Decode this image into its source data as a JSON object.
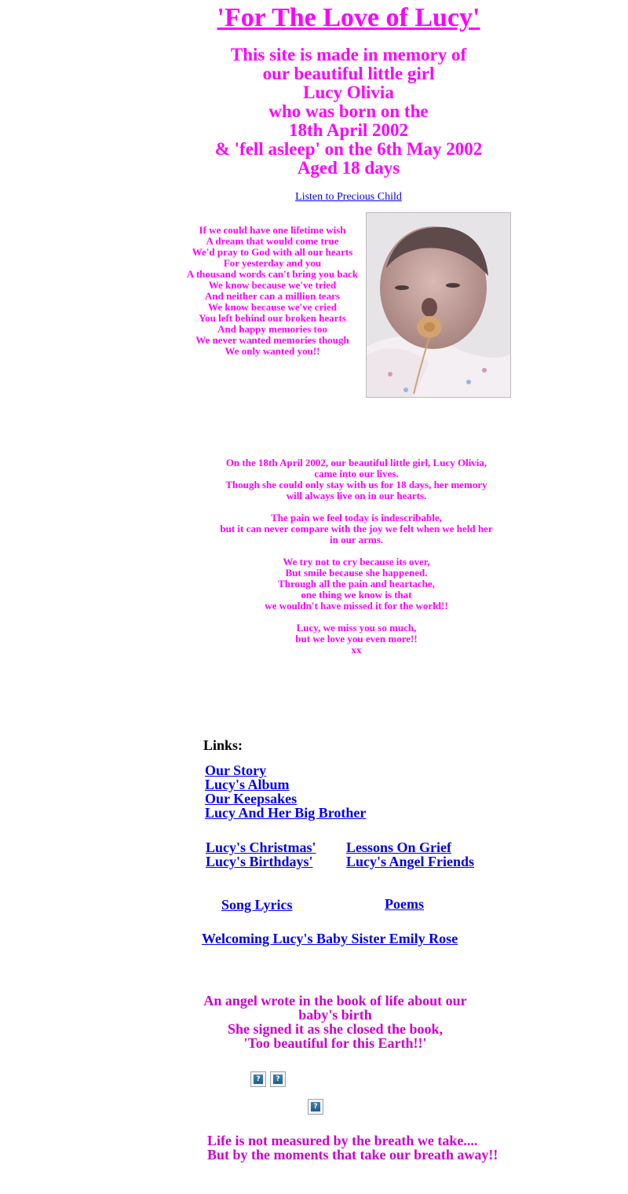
{
  "title": "'For The Love of Lucy'",
  "memorial": [
    "This site is made in memory of",
    "our beautiful little girl",
    "Lucy Olivia",
    "who was born on the",
    "18th April 2002",
    "& 'fell asleep' on the 6th May 2002",
    "Aged 18 days"
  ],
  "listen_link": "Listen to Precious Child",
  "poem": [
    "If we could have one lifetime wish",
    "A dream that would come true",
    "We'd pray to God with all our hearts",
    "For yesterday and you",
    "A thousand words can't bring you back",
    "We know because we've tried",
    "And neither can a million tears",
    "We know because we've cried",
    "You left behind our broken hearts",
    "And happy memories too",
    "We never wanted memories though",
    "We only wanted you!!"
  ],
  "photo_icon": "baby-photo",
  "story": [
    [
      "On the 18th April 2002, our beautiful little girl, Lucy Olivia,",
      "came into our lives.",
      "Though she could only stay with us for 18 days, her memory",
      "will always live on in our hearts."
    ],
    [
      "The pain we feel today is indescribable,",
      "but it can never compare with the joy we felt when we held her",
      "in our arms."
    ],
    [
      "We try not to cry because its over,",
      "But smile because she happened.",
      "Through all the pain and heartache,",
      "one thing we know is that",
      "we wouldn't have missed it for the world!!"
    ],
    [
      "Lucy, we miss you so much,",
      "but we love you even more!!",
      "xx"
    ]
  ],
  "links_heading": "Links:",
  "links_main": [
    "Our Story",
    "Lucy's Album",
    "Our Keepsakes",
    "Lucy And Her Big Brother"
  ],
  "links_col1": [
    "Lucy's Christmas'",
    "Lucy's Birthdays'"
  ],
  "links_col2": [
    "Lessons On Grief",
    "Lucy's Angel Friends"
  ],
  "song_lyrics": "Song Lyrics",
  "poems": "Poems",
  "welcome_link": "Welcoming Lucy's Baby Sister Emily Rose",
  "angel_lines": [
    "An angel wrote in the book of life about our",
    "baby's birth",
    "She signed it as she closed the book,",
    "'Too beautiful for this Earth!!'"
  ],
  "icon_glyph": "?",
  "closing_lines": [
    "Life is not measured by the breath we take....",
    "But by the moments that take our breath away!!"
  ],
  "colors": {
    "text_pink": "#ff00ff",
    "text_purple": "#cc00cc",
    "link_blue": "#0000ee"
  }
}
